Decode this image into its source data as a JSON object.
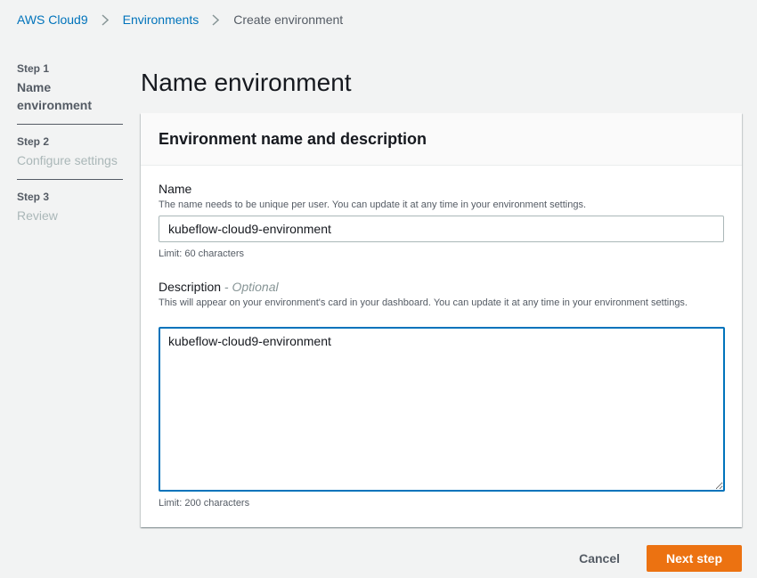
{
  "breadcrumb": {
    "items": [
      "AWS Cloud9",
      "Environments"
    ],
    "current": "Create environment"
  },
  "steps": [
    {
      "number": "Step 1",
      "title": "Name environment",
      "state": "active"
    },
    {
      "number": "Step 2",
      "title": "Configure settings",
      "state": "inactive"
    },
    {
      "number": "Step 3",
      "title": "Review",
      "state": "inactive"
    }
  ],
  "page_title": "Name environment",
  "panel": {
    "title": "Environment name and description",
    "name_field": {
      "label": "Name",
      "description": "The name needs to be unique per user. You can update it at any time in your environment settings.",
      "value": "kubeflow-cloud9-environment",
      "limit": "Limit: 60 characters"
    },
    "description_field": {
      "label": "Description",
      "optional": "- Optional",
      "description": "This will appear on your environment's card in your dashboard. You can update it at any time in your environment settings.",
      "value": "kubeflow-cloud9-environment",
      "limit": "Limit: 200 characters"
    }
  },
  "actions": {
    "cancel": "Cancel",
    "next": "Next step"
  },
  "colors": {
    "link": "#0073bb",
    "primary_button": "#ec7211",
    "focus_border": "#0073bb"
  }
}
